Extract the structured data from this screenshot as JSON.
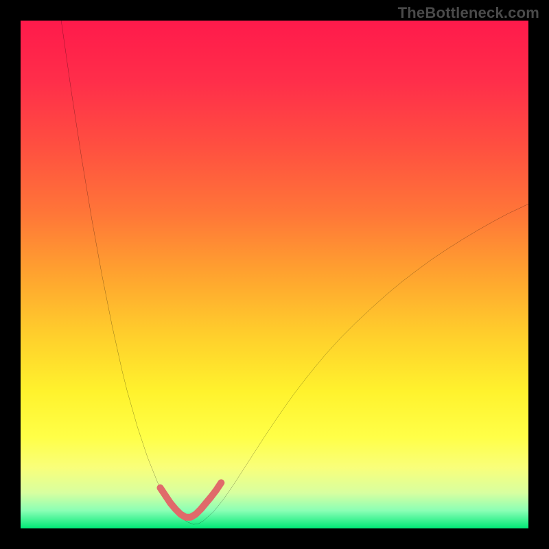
{
  "watermark": "TheBottleneck.com",
  "chart_data": {
    "type": "line",
    "title": "",
    "xlabel": "",
    "ylabel": "",
    "xlim": [
      0,
      100
    ],
    "ylim": [
      0,
      100
    ],
    "background_gradient_stops": [
      {
        "offset": 0.0,
        "color": "#ff1a4b"
      },
      {
        "offset": 0.12,
        "color": "#ff2e4a"
      },
      {
        "offset": 0.25,
        "color": "#ff5040"
      },
      {
        "offset": 0.38,
        "color": "#ff7638"
      },
      {
        "offset": 0.5,
        "color": "#ffa32f"
      },
      {
        "offset": 0.62,
        "color": "#ffcf2c"
      },
      {
        "offset": 0.73,
        "color": "#fff22d"
      },
      {
        "offset": 0.82,
        "color": "#ffff47"
      },
      {
        "offset": 0.88,
        "color": "#f9ff7a"
      },
      {
        "offset": 0.93,
        "color": "#d8ffa0"
      },
      {
        "offset": 0.965,
        "color": "#8affb5"
      },
      {
        "offset": 1.0,
        "color": "#00e876"
      }
    ],
    "series": [
      {
        "name": "curve",
        "stroke": "#000000",
        "stroke_width": 1.6,
        "x": [
          8.0,
          9.0,
          10.0,
          11.0,
          12.0,
          13.0,
          14.0,
          15.0,
          16.0,
          17.0,
          18.0,
          19.0,
          20.0,
          21.0,
          22.0,
          23.0,
          24.0,
          25.0,
          26.0,
          27.0,
          28.0,
          29.0,
          30.0,
          31.0,
          32.0,
          33.0,
          34.0,
          35.0,
          36.0,
          38.0,
          40.0,
          42.0,
          44.0,
          46.0,
          48.0,
          50.0,
          52.0,
          54.0,
          56.0,
          58.0,
          60.0,
          63.0,
          66.0,
          69.0,
          72.0,
          75.0,
          78.0,
          81.0,
          84.0,
          87.0,
          90.0,
          93.0,
          96.0,
          99.0,
          100.0
        ],
        "y": [
          100.0,
          93.0,
          86.0,
          79.5,
          73.0,
          67.0,
          61.0,
          55.5,
          50.0,
          45.0,
          40.0,
          35.5,
          31.0,
          27.0,
          23.5,
          20.0,
          17.0,
          14.0,
          11.5,
          9.0,
          7.0,
          5.2,
          3.8,
          2.6,
          1.8,
          1.2,
          0.8,
          0.9,
          1.5,
          3.3,
          5.8,
          8.7,
          11.8,
          14.9,
          18.0,
          21.0,
          23.9,
          26.7,
          29.3,
          31.8,
          34.2,
          37.5,
          40.5,
          43.3,
          46.0,
          48.5,
          50.8,
          53.0,
          55.0,
          56.9,
          58.7,
          60.4,
          62.0,
          63.4,
          63.9
        ]
      },
      {
        "name": "valley-highlight",
        "stroke": "#e06a6a",
        "stroke_width": 10,
        "linecap": "round",
        "x": [
          27.5,
          28.5,
          29.5,
          30.5,
          31.5,
          32.5,
          33.5,
          34.5,
          35.5,
          36.5,
          37.5,
          38.5,
          39.5
        ],
        "y": [
          8.0,
          6.5,
          5.0,
          3.8,
          2.8,
          2.2,
          2.2,
          2.8,
          3.8,
          5.0,
          6.2,
          7.5,
          9.0
        ]
      }
    ]
  }
}
